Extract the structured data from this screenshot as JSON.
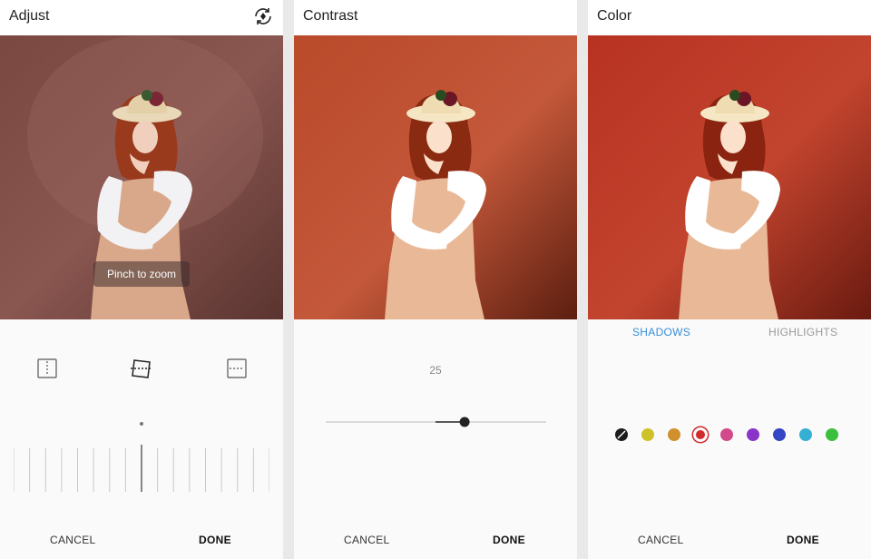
{
  "panels": [
    {
      "title": "Adjust",
      "toast": "Pinch to zoom",
      "cancel_label": "CANCEL",
      "done_label": "DONE",
      "icons": [
        "rotate-icon",
        "vertical-perspective-icon",
        "straighten-icon",
        "horizontal-perspective-icon"
      ]
    },
    {
      "title": "Contrast",
      "value": "25",
      "slider_fraction": 0.63,
      "cancel_label": "CANCEL",
      "done_label": "DONE"
    },
    {
      "title": "Color",
      "tabs": [
        "SHADOWS",
        "HIGHLIGHTS"
      ],
      "active_tab": "SHADOWS",
      "swatches": [
        "#1d1d1d",
        "#cfc229",
        "#d1902d",
        "#d22b2b",
        "#d24a8b",
        "#8a34c9",
        "#3445c5",
        "#35b0d2",
        "#3cbf3c"
      ],
      "selected_swatch": 3,
      "cancel_label": "CANCEL",
      "done_label": "DONE"
    }
  ],
  "colors": {
    "accent": "#3a8ed8",
    "dark": "#222222"
  }
}
